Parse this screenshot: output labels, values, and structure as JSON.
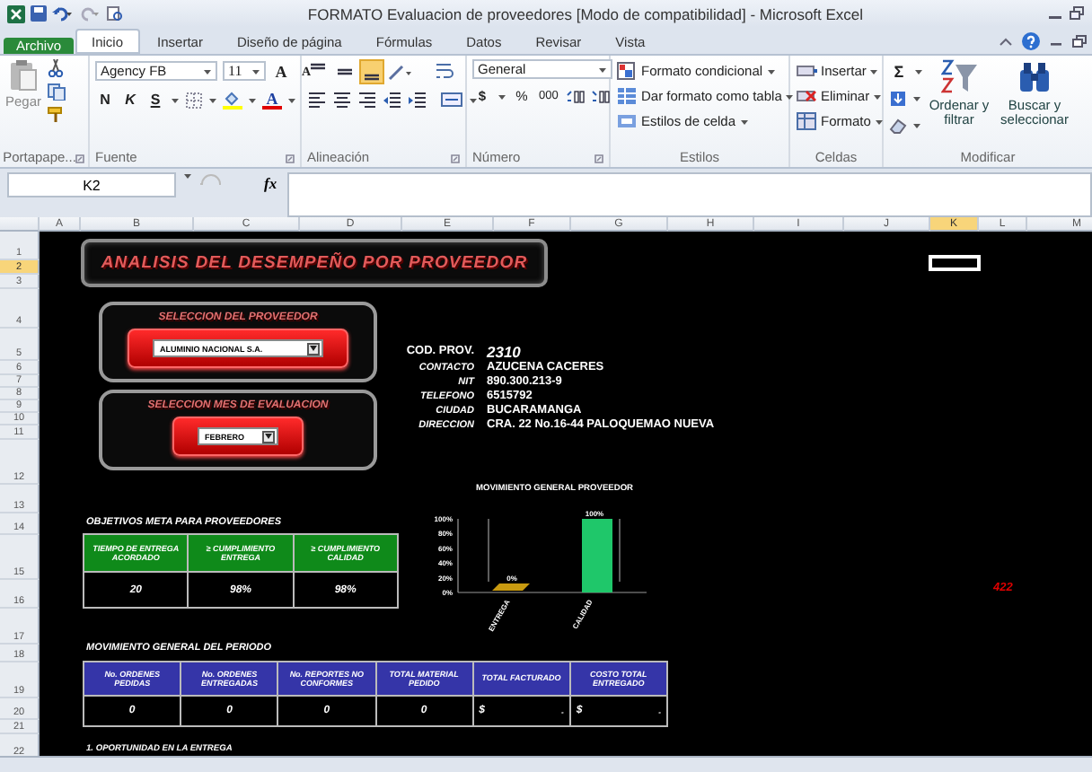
{
  "window": {
    "title": "FORMATO Evaluacion de proveedores  [Modo de compatibilidad]  -  Microsoft Excel"
  },
  "ribbon_tabs": [
    {
      "label": "Archivo",
      "kind": "file",
      "selected": false
    },
    {
      "label": "Inicio",
      "kind": "tab",
      "selected": true
    },
    {
      "label": "Insertar",
      "kind": "tab",
      "selected": false
    },
    {
      "label": "Diseño de página",
      "kind": "tab",
      "selected": false
    },
    {
      "label": "Fórmulas",
      "kind": "tab",
      "selected": false
    },
    {
      "label": "Datos",
      "kind": "tab",
      "selected": false
    },
    {
      "label": "Revisar",
      "kind": "tab",
      "selected": false
    },
    {
      "label": "Vista",
      "kind": "tab",
      "selected": false
    }
  ],
  "ribbon_groups": [
    {
      "kind": "clipboard",
      "label": "Portapape...",
      "paste": "Pegar"
    },
    {
      "kind": "font",
      "label": "Fuente",
      "font": "Agency FB",
      "size": "11",
      "grow": "A",
      "shrink": "A",
      "bold": "N",
      "italic": "K",
      "underline": "S",
      "font_color": "A"
    },
    {
      "kind": "alignment",
      "label": "Alineación",
      "vertical": [
        {
          "kind": "top",
          "on": false
        },
        {
          "kind": "middle",
          "on": false
        },
        {
          "kind": "bottom",
          "on": true
        }
      ]
    },
    {
      "kind": "number",
      "label": "Número",
      "format": "General",
      "currency": "$",
      "percent": "%",
      "thousands": "000"
    },
    {
      "kind": "styles",
      "label": "Estilos",
      "items": [
        "Formato condicional",
        "Dar formato como tabla",
        "Estilos de celda"
      ]
    },
    {
      "kind": "cells",
      "label": "Celdas",
      "items": [
        "Insertar",
        "Eliminar",
        "Formato"
      ]
    },
    {
      "kind": "editing",
      "label": "Modificar",
      "sum": "Σ",
      "sort": "Ordenar y filtrar",
      "find": "Buscar y seleccionar"
    }
  ],
  "formula_bar": {
    "name_box": "K2",
    "function_label": "fx"
  },
  "sheet": {
    "columns": [
      {
        "label": "A",
        "selected": false
      },
      {
        "label": "B",
        "selected": false
      },
      {
        "label": "C",
        "selected": false
      },
      {
        "label": "D",
        "selected": false
      },
      {
        "label": "E",
        "selected": false
      },
      {
        "label": "F",
        "selected": false
      },
      {
        "label": "G",
        "selected": false
      },
      {
        "label": "H",
        "selected": false
      },
      {
        "label": "I",
        "selected": false
      },
      {
        "label": "J",
        "selected": false
      },
      {
        "label": "K",
        "selected": true
      },
      {
        "label": "L",
        "selected": false
      },
      {
        "label": "M",
        "selected": false
      }
    ],
    "rows": [
      {
        "label": "1",
        "selected": false
      },
      {
        "label": "2",
        "selected": true
      },
      {
        "label": "3",
        "selected": false
      },
      {
        "label": "4",
        "selected": false
      },
      {
        "label": "5",
        "selected": false
      },
      {
        "label": "6",
        "selected": false
      },
      {
        "label": "7",
        "selected": false
      },
      {
        "label": "8",
        "selected": false
      },
      {
        "label": "9",
        "selected": false
      },
      {
        "label": "10",
        "selected": false
      },
      {
        "label": "11",
        "selected": false
      },
      {
        "label": "12",
        "selected": false
      },
      {
        "label": "13",
        "selected": false
      },
      {
        "label": "14",
        "selected": false
      },
      {
        "label": "15",
        "selected": false
      },
      {
        "label": "16",
        "selected": false
      },
      {
        "label": "17",
        "selected": false
      },
      {
        "label": "18",
        "selected": false
      },
      {
        "label": "19",
        "selected": false
      },
      {
        "label": "20",
        "selected": false
      },
      {
        "label": "21",
        "selected": false
      },
      {
        "label": "22",
        "selected": false
      }
    ]
  },
  "dashboard": {
    "title": "ANALISIS  DEL  DESEMPEÑO POR  PROVEEDOR",
    "supplier": {
      "label": "SELECCION DEL PROVEEDOR",
      "value": "ALUMINIO NACIONAL S.A."
    },
    "month": {
      "label": "SELECCION MES DE EVALUACION",
      "value": "FEBRERO"
    },
    "info": [
      {
        "label": "COD. PROV.",
        "value": "2310"
      },
      {
        "label": "CONTACTO",
        "value": "AZUCENA  CACERES"
      },
      {
        "label": "NIT",
        "value": "890.300.213-9"
      },
      {
        "label": "TELEFONO",
        "value": "6515792"
      },
      {
        "label": "CIUDAD",
        "value": "BUCARAMANGA"
      },
      {
        "label": "DIRECCION",
        "value": "CRA. 22 No.16-44 PALOQUEMAO NUEVA"
      }
    ],
    "goals": {
      "title": "OBJETIVOS META PARA PROVEEDORES",
      "headers": [
        "TIEMPO DE ENTREGA ACORDADO",
        "≥ CUMPLIMIENTO ENTREGA",
        "≥ CUMPLIMIENTO CALIDAD"
      ],
      "values": [
        "20",
        "98%",
        "98%"
      ]
    },
    "chart": {
      "title": "MOVIMIENTO  GENERAL  PROVEEDOR",
      "chart_data": {
        "type": "bar",
        "categories": [
          "ENTREGA",
          "CALIDAD"
        ],
        "values": [
          0,
          100
        ],
        "colors": [
          "#c89a10",
          "#1fc76a"
        ],
        "ylim": [
          0,
          100
        ],
        "yticks": [
          {
            "value": 0,
            "label": "0%"
          },
          {
            "value": 20,
            "label": "20%"
          },
          {
            "value": 40,
            "label": "40%"
          },
          {
            "value": 60,
            "label": "60%"
          },
          {
            "value": 80,
            "label": "80%"
          },
          {
            "value": 100,
            "label": "100%"
          }
        ],
        "value_labels": [
          "0%",
          "100%"
        ]
      }
    },
    "marker": "422",
    "period": {
      "title": "MOVIMIENTO GENERAL DEL PERIODO",
      "columns": [
        {
          "header": "No. ORDENES PEDIDAS",
          "kind": "number",
          "value": "0"
        },
        {
          "header": "No. ORDENES ENTREGADAS",
          "kind": "number",
          "value": "0"
        },
        {
          "header": "No. REPORTES NO CONFORMES",
          "kind": "number",
          "value": "0"
        },
        {
          "header": "TOTAL MATERIAL PEDIDO",
          "kind": "number",
          "value": "0"
        },
        {
          "header": "TOTAL FACTURADO",
          "kind": "currency",
          "symbol": "$",
          "value": "-"
        },
        {
          "header": "COSTO TOTAL ENTREGADO",
          "kind": "currency",
          "symbol": "$",
          "value": "-"
        }
      ]
    },
    "section": "1. OPORTUNIDAD EN LA ENTREGA"
  }
}
